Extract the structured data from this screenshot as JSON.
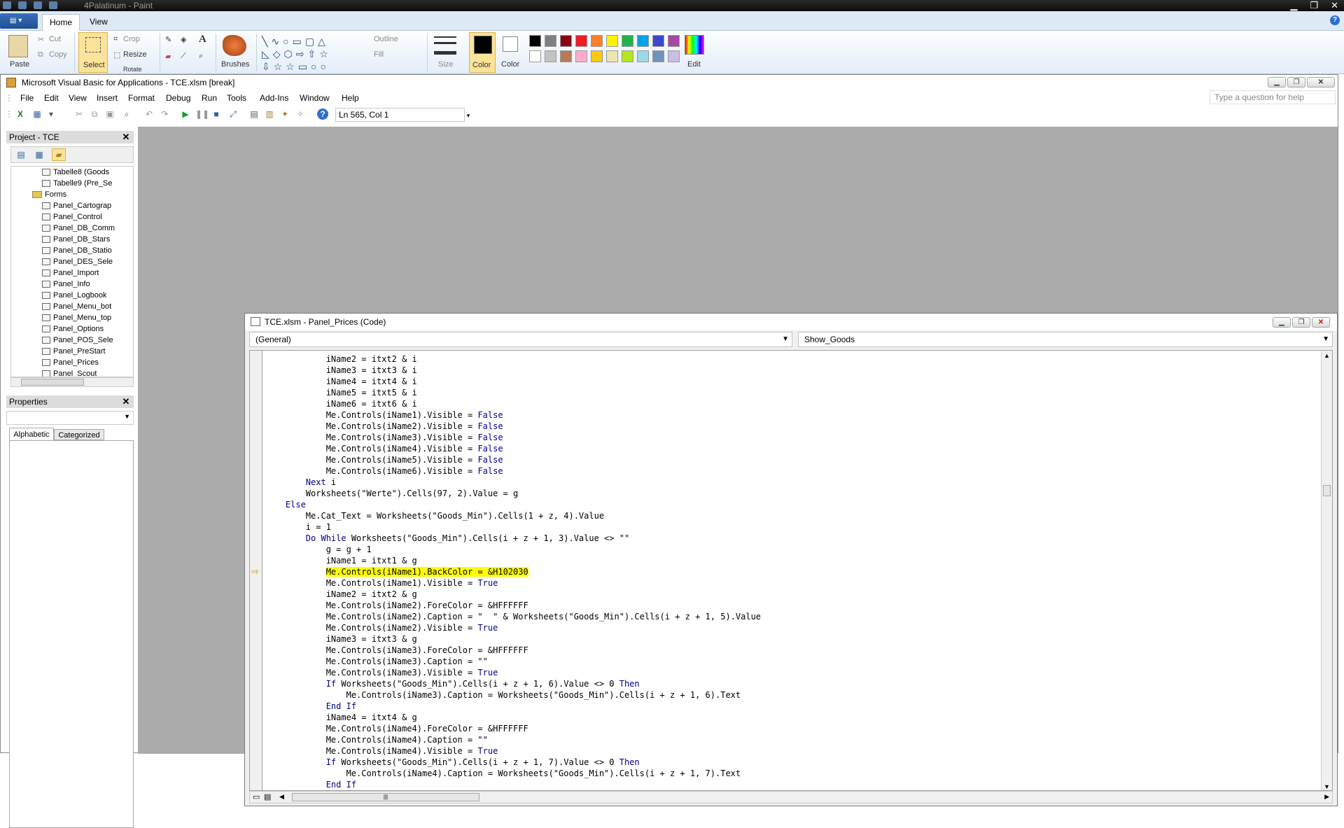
{
  "paint": {
    "title": "4Palatinum - Paint",
    "tabs": [
      "Home",
      "View"
    ],
    "clipboard": {
      "paste": "Paste",
      "cut": "Cut",
      "copy": "Copy"
    },
    "image": {
      "select": "Select",
      "crop": "Crop",
      "resize": "Resize",
      "rotate": "Rotate"
    },
    "tools": {
      "brushes": "Brushes"
    },
    "shapes": {
      "outline": "Outline",
      "fill": "Fill"
    },
    "size_label": "Size",
    "color1_label": "Color",
    "color2_label": "Color",
    "edit_colors_label": "Edit",
    "palette_row1": [
      "#000000",
      "#7f7f7f",
      "#880015",
      "#ed1c24",
      "#ff7f27",
      "#fff200",
      "#22b14c",
      "#00a2e8",
      "#3f48cc",
      "#a349a4"
    ],
    "palette_row2": [
      "#ffffff",
      "#c3c3c3",
      "#b97a57",
      "#ffaec9",
      "#ffc90e",
      "#efe4b0",
      "#b5e61d",
      "#99d9ea",
      "#7092be",
      "#c8bfe7"
    ]
  },
  "vba": {
    "title": "Microsoft Visual Basic for Applications - TCE.xlsm [break]",
    "menu": [
      "File",
      "Edit",
      "View",
      "Insert",
      "Format",
      "Debug",
      "Run",
      "Tools",
      "Add-Ins",
      "Window",
      "Help"
    ],
    "help_placeholder": "Type a question for help",
    "position": "Ln 565, Col 1",
    "project": {
      "header": "Project - TCE",
      "items": [
        {
          "label": "Tabelle8 (Goods",
          "kind": "sheet",
          "indent": 2
        },
        {
          "label": "Tabelle9 (Pre_Se",
          "kind": "sheet",
          "indent": 2
        },
        {
          "label": "Forms",
          "kind": "folder",
          "indent": 1
        },
        {
          "label": "Panel_Cartograp",
          "kind": "form",
          "indent": 2
        },
        {
          "label": "Panel_Control",
          "kind": "form",
          "indent": 2
        },
        {
          "label": "Panel_DB_Comm",
          "kind": "form",
          "indent": 2
        },
        {
          "label": "Panel_DB_Stars",
          "kind": "form",
          "indent": 2
        },
        {
          "label": "Panel_DB_Statio",
          "kind": "form",
          "indent": 2
        },
        {
          "label": "Panel_DES_Sele",
          "kind": "form",
          "indent": 2
        },
        {
          "label": "Panel_Import",
          "kind": "form",
          "indent": 2
        },
        {
          "label": "Panel_Info",
          "kind": "form",
          "indent": 2
        },
        {
          "label": "Panel_Logbook",
          "kind": "form",
          "indent": 2
        },
        {
          "label": "Panel_Menu_bot",
          "kind": "form",
          "indent": 2
        },
        {
          "label": "Panel_Menu_top",
          "kind": "form",
          "indent": 2
        },
        {
          "label": "Panel_Options",
          "kind": "form",
          "indent": 2
        },
        {
          "label": "Panel_POS_Sele",
          "kind": "form",
          "indent": 2
        },
        {
          "label": "Panel_PreStart",
          "kind": "form",
          "indent": 2
        },
        {
          "label": "Panel_Prices",
          "kind": "form",
          "indent": 2
        },
        {
          "label": "Panel_Scout",
          "kind": "form",
          "indent": 2
        }
      ]
    },
    "properties": {
      "header": "Properties",
      "tabs": [
        "Alphabetic",
        "Categorized"
      ]
    },
    "code_window": {
      "title": "TCE.xlsm - Panel_Prices (Code)",
      "object_combo": "(General)",
      "proc_combo": "Show_Goods",
      "current_line_index": 19,
      "lines": [
        "            iName2 = itxt2 & i",
        "            iName3 = itxt3 & i",
        "            iName4 = itxt4 & i",
        "            iName5 = itxt5 & i",
        "            iName6 = itxt6 & i",
        "            Me.Controls(iName1).Visible = False",
        "            Me.Controls(iName2).Visible = False",
        "            Me.Controls(iName3).Visible = False",
        "            Me.Controls(iName4).Visible = False",
        "            Me.Controls(iName5).Visible = False",
        "            Me.Controls(iName6).Visible = False",
        "        Next i",
        "        Worksheets(\"Werte\").Cells(97, 2).Value = g",
        "    Else",
        "        Me.Cat_Text = Worksheets(\"Goods_Min\").Cells(1 + z, 4).Value",
        "        i = 1",
        "        Do While Worksheets(\"Goods_Min\").Cells(i + z + 1, 3).Value <> \"\"",
        "            g = g + 1",
        "            iName1 = itxt1 & g",
        "            Me.Controls(iName1).BackColor = &H102030",
        "            Me.Controls(iName1).Visible = True",
        "            iName2 = itxt2 & g",
        "            Me.Controls(iName2).ForeColor = &HFFFFFF",
        "            Me.Controls(iName2).Caption = \"  \" & Worksheets(\"Goods_Min\").Cells(i + z + 1, 5).Value",
        "            Me.Controls(iName2).Visible = True",
        "            iName3 = itxt3 & g",
        "            Me.Controls(iName3).ForeColor = &HFFFFFF",
        "            Me.Controls(iName3).Caption = \"\"",
        "            Me.Controls(iName3).Visible = True",
        "            If Worksheets(\"Goods_Min\").Cells(i + z + 1, 6).Value <> 0 Then",
        "                Me.Controls(iName3).Caption = Worksheets(\"Goods_Min\").Cells(i + z + 1, 6).Text",
        "            End If",
        "            iName4 = itxt4 & g",
        "            Me.Controls(iName4).ForeColor = &HFFFFFF",
        "            Me.Controls(iName4).Caption = \"\"",
        "            Me.Controls(iName4).Visible = True",
        "            If Worksheets(\"Goods_Min\").Cells(i + z + 1, 7).Value <> 0 Then",
        "                Me.Controls(iName4).Caption = Worksheets(\"Goods_Min\").Cells(i + z + 1, 7).Text",
        "            End If"
      ]
    }
  },
  "colors": {
    "keyword": "#00008b",
    "highlight": "#ffff00",
    "mdi_bg": "#ababab"
  }
}
